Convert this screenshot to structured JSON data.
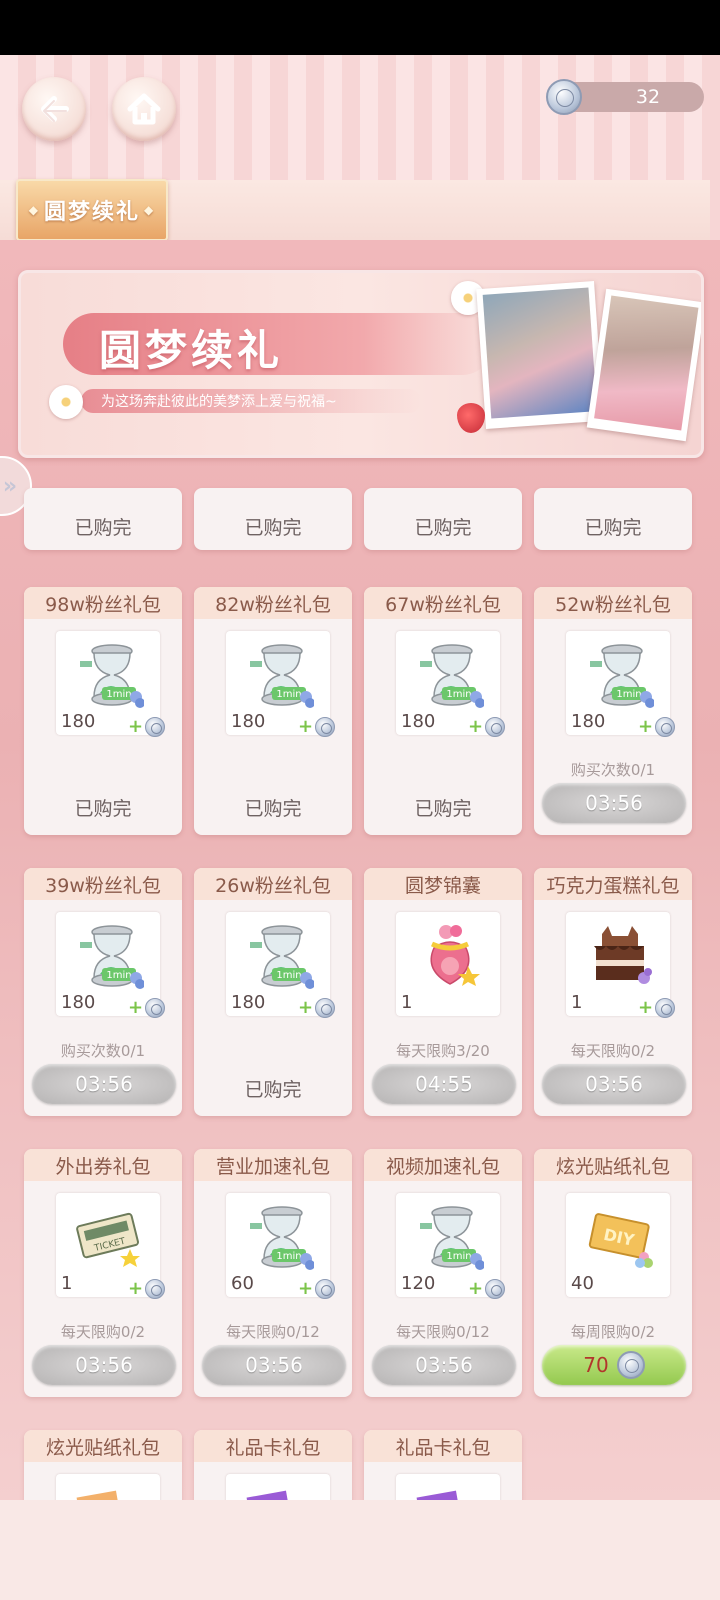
{
  "header": {
    "back_icon": "back-arrow-icon",
    "home_icon": "home-icon",
    "currency_value": "32",
    "currency_icon": "coin-icon"
  },
  "tabs": [
    {
      "label": "圆梦续礼",
      "active": true
    }
  ],
  "banner": {
    "title": "圆梦续礼",
    "subtitle": "为这场奔赴彼此的美梦添上爱与祝福~"
  },
  "top_row": [
    {
      "status": "已购完"
    },
    {
      "status": "已购完"
    },
    {
      "status": "已购完"
    },
    {
      "status": "已购完"
    }
  ],
  "packs": [
    {
      "title": "98w粉丝礼包",
      "item_icon": "hourglass-1min-icon",
      "qty": "180",
      "bonus_icon": "coin-icon",
      "limit": "",
      "status": "已购完",
      "timer": "",
      "price": ""
    },
    {
      "title": "82w粉丝礼包",
      "item_icon": "hourglass-1min-icon",
      "qty": "180",
      "bonus_icon": "coin-icon",
      "limit": "",
      "status": "已购完",
      "timer": "",
      "price": ""
    },
    {
      "title": "67w粉丝礼包",
      "item_icon": "hourglass-1min-icon",
      "qty": "180",
      "bonus_icon": "coin-icon",
      "limit": "",
      "status": "已购完",
      "timer": "",
      "price": ""
    },
    {
      "title": "52w粉丝礼包",
      "item_icon": "hourglass-1min-icon",
      "qty": "180",
      "bonus_icon": "coin-icon",
      "limit": "购买次数0/1",
      "status": "",
      "timer": "03:56",
      "price": ""
    },
    {
      "title": "39w粉丝礼包",
      "item_icon": "hourglass-1min-icon",
      "qty": "180",
      "bonus_icon": "coin-icon",
      "limit": "购买次数0/1",
      "status": "",
      "timer": "03:56",
      "price": ""
    },
    {
      "title": "26w粉丝礼包",
      "item_icon": "hourglass-1min-icon",
      "qty": "180",
      "bonus_icon": "coin-icon",
      "limit": "",
      "status": "已购完",
      "timer": "",
      "price": ""
    },
    {
      "title": "圆梦锦囊",
      "item_icon": "dream-pouch-icon",
      "qty": "1",
      "bonus_icon": "",
      "limit": "每天限购3/20",
      "status": "",
      "timer": "04:55",
      "price": ""
    },
    {
      "title": "巧克力蛋糕礼包",
      "item_icon": "chocolate-cake-icon",
      "qty": "1",
      "bonus_icon": "coin-icon",
      "limit": "每天限购0/2",
      "status": "",
      "timer": "03:56",
      "price": ""
    },
    {
      "title": "外出券礼包",
      "item_icon": "ticket-icon",
      "qty": "1",
      "bonus_icon": "coin-icon",
      "limit": "每天限购0/2",
      "status": "",
      "timer": "03:56",
      "price": ""
    },
    {
      "title": "营业加速礼包",
      "item_icon": "hourglass-1min-icon",
      "qty": "60",
      "bonus_icon": "coin-icon",
      "limit": "每天限购0/12",
      "status": "",
      "timer": "03:56",
      "price": ""
    },
    {
      "title": "视频加速礼包",
      "item_icon": "hourglass-1min-icon",
      "qty": "120",
      "bonus_icon": "coin-icon",
      "limit": "每天限购0/12",
      "status": "",
      "timer": "03:56",
      "price": ""
    },
    {
      "title": "炫光贴纸礼包",
      "item_icon": "diy-sticker-icon",
      "qty": "40",
      "bonus_icon": "",
      "limit": "每周限购0/2",
      "status": "",
      "timer": "",
      "price": "70"
    },
    {
      "title": "炫光贴纸礼包",
      "item_icon": "sticker-icon",
      "qty": "",
      "bonus_icon": "",
      "limit": "",
      "status": "",
      "timer": "",
      "price": ""
    },
    {
      "title": "礼品卡礼包",
      "item_icon": "gift-card-icon",
      "qty": "",
      "bonus_icon": "",
      "limit": "",
      "status": "",
      "timer": "",
      "price": ""
    },
    {
      "title": "礼品卡礼包",
      "item_icon": "gift-card-icon",
      "qty": "",
      "bonus_icon": "",
      "limit": "",
      "status": "",
      "timer": "",
      "price": ""
    }
  ],
  "hourglass_label": "1min",
  "colors": {
    "accent_tab": "#e8a567",
    "card_header": "#f9e2d7",
    "price_button": "#94c94f",
    "timer_button": "#b6b4b4"
  }
}
